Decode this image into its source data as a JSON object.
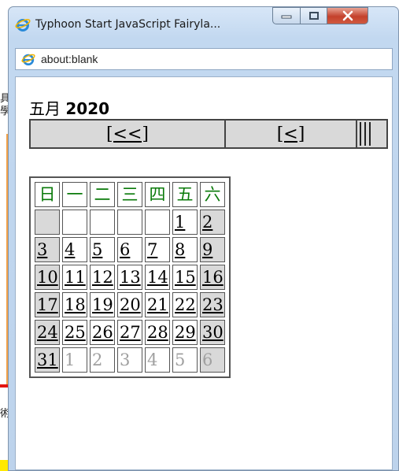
{
  "window": {
    "title": "Typhoon Start JavaScript Fairyla...",
    "address": "about:blank"
  },
  "calendar": {
    "month_label": "五月",
    "year_label": "2020",
    "nav": {
      "prev_year": "[<<]",
      "prev_month": "[<]"
    },
    "weekdays": [
      "日",
      "一",
      "二",
      "三",
      "四",
      "五",
      "六"
    ],
    "weeks": [
      [
        "",
        "",
        "",
        "",
        "",
        "1",
        "2"
      ],
      [
        "3",
        "4",
        "5",
        "6",
        "7",
        "8",
        "9"
      ],
      [
        "10",
        "11",
        "12",
        "13",
        "14",
        "15",
        "16"
      ],
      [
        "17",
        "18",
        "19",
        "20",
        "21",
        "22",
        "23"
      ],
      [
        "24",
        "25",
        "26",
        "27",
        "28",
        "29",
        "30"
      ],
      [
        "31",
        "1",
        "2",
        "3",
        "4",
        "5",
        "6"
      ]
    ]
  },
  "colors": {
    "weekday_header": "#0a7a0a",
    "weekend_shade": "#d9d9d9",
    "other_month_text": "#a0a0a0",
    "close_button": "#c4412c"
  }
}
